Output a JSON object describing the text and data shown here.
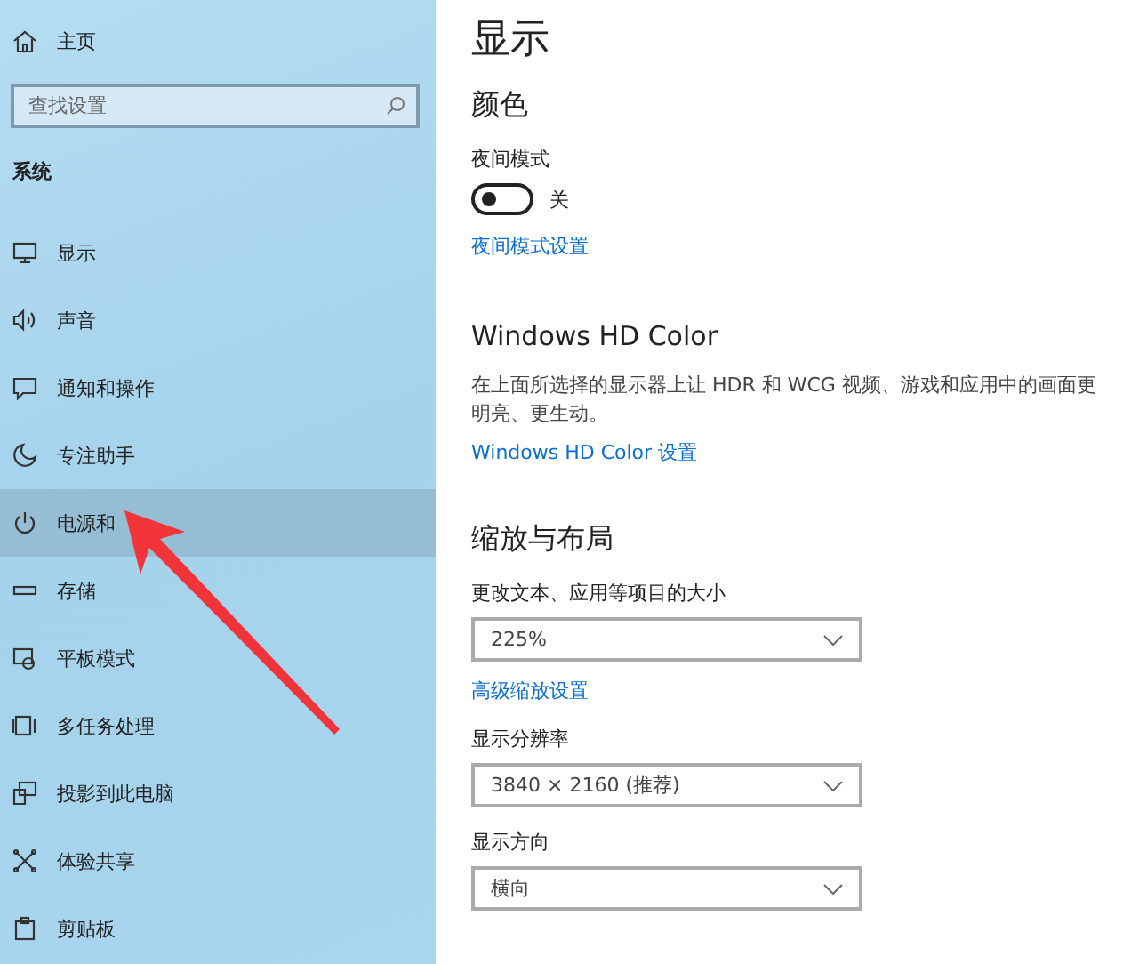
{
  "sidebar": {
    "home": "主页",
    "search": {
      "placeholder": "查找设置"
    },
    "section": "系统",
    "items": [
      {
        "label": "显示",
        "selected": false
      },
      {
        "label": "声音",
        "selected": false
      },
      {
        "label": "通知和操作",
        "selected": false
      },
      {
        "label": "专注助手",
        "selected": false
      },
      {
        "label": "电源和",
        "selected": true
      },
      {
        "label": "存储",
        "selected": false
      },
      {
        "label": "平板模式",
        "selected": false
      },
      {
        "label": "多任务处理",
        "selected": false
      },
      {
        "label": "投影到此电脑",
        "selected": false
      },
      {
        "label": "体验共享",
        "selected": false
      },
      {
        "label": "剪贴板",
        "selected": false
      }
    ]
  },
  "page": {
    "title": "显示",
    "color_section": {
      "heading": "颜色",
      "night_label": "夜间模式",
      "night_toggle": {
        "on": false,
        "state": "关"
      },
      "link": "夜间模式设置"
    },
    "hdr_section": {
      "heading": "Windows HD Color",
      "description": "在上面所选择的显示器上让 HDR 和 WCG 视频、游戏和应用中的画面更明亮、更生动。",
      "link": "Windows HD Color 设置"
    },
    "scale_section": {
      "heading": "缩放与布局",
      "fields": [
        {
          "kind": "dropdown",
          "label": "更改文本、应用等项目的大小",
          "value": "225%"
        },
        {
          "kind": "link",
          "label": "高级缩放设置"
        },
        {
          "kind": "dropdown",
          "label": "显示分辨率",
          "value": "3840 × 2160 (推荐)"
        },
        {
          "kind": "dropdown",
          "label": "显示方向",
          "value": "横向"
        }
      ]
    }
  }
}
